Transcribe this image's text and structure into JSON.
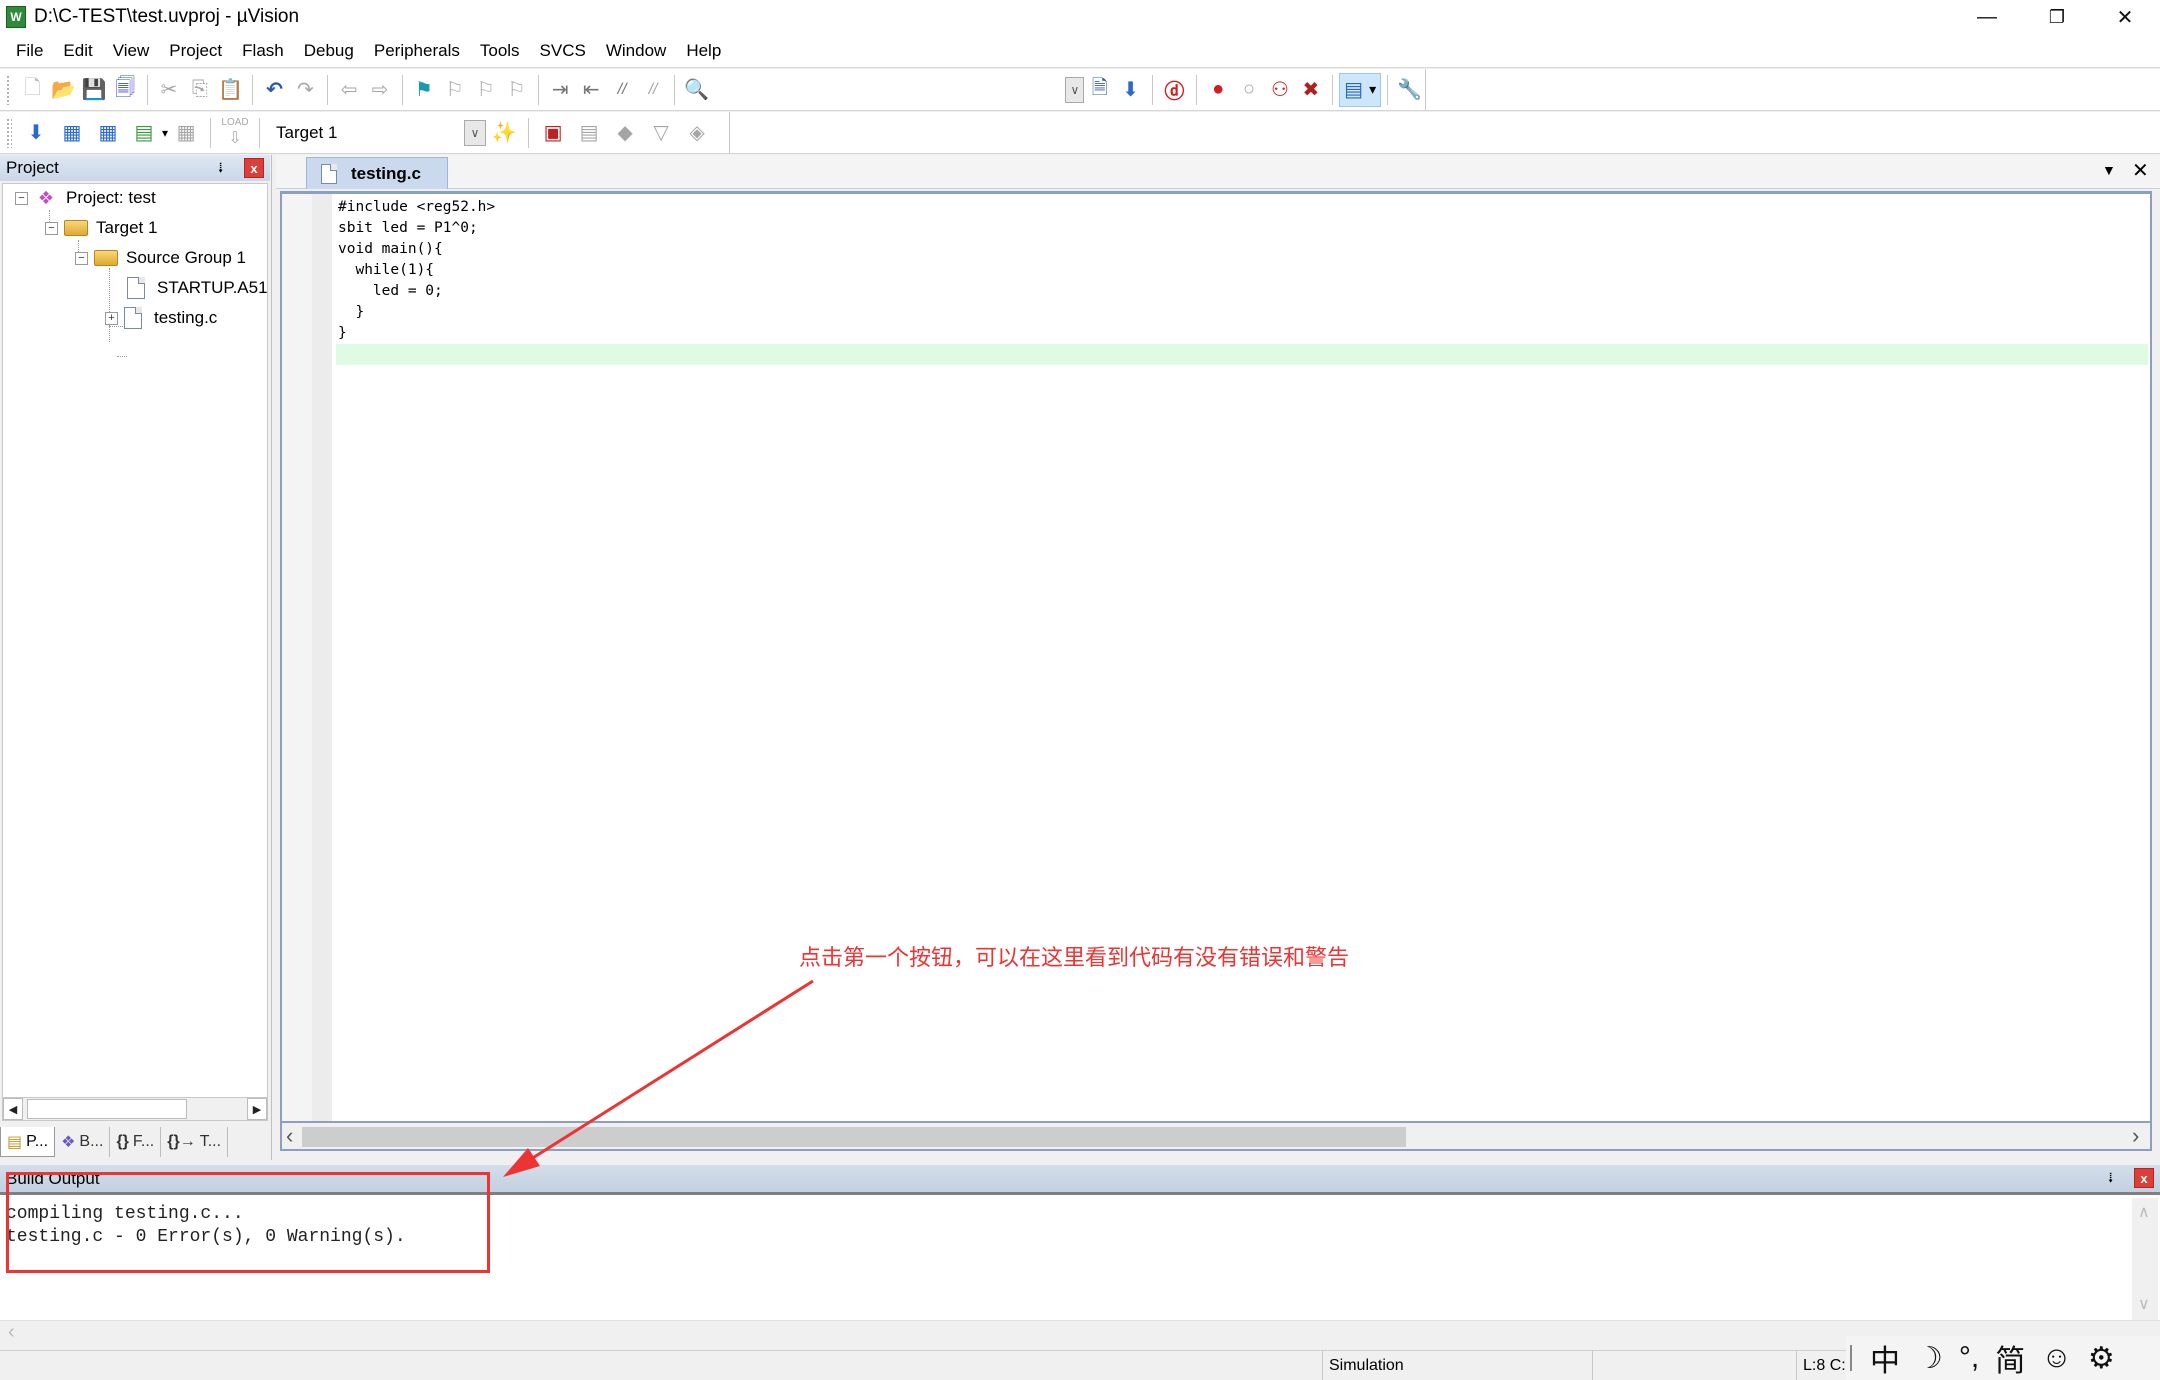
{
  "window": {
    "title": "D:\\C-TEST\\test.uvproj - µVision",
    "app_icon_label": "W",
    "minimize_glyph": "—",
    "restore_glyph": "❐",
    "close_glyph": "✕"
  },
  "menu": [
    "File",
    "Edit",
    "View",
    "Project",
    "Flash",
    "Debug",
    "Peripherals",
    "Tools",
    "SVCS",
    "Window",
    "Help"
  ],
  "toolbar1": {
    "icons": {
      "new": "🗋",
      "open": "📂",
      "save": "💾",
      "save_all": "🗐",
      "cut": "✂",
      "copy": "⎘",
      "paste": "📋",
      "undo": "↶",
      "redo": "↷",
      "nav_back": "⇦",
      "nav_forward": "⇨",
      "bookmark": "⚑",
      "prev_bookmark": "⚐",
      "next_bookmark": "⚐",
      "clear_bookmarks": "⚐",
      "indent": "⇥",
      "unindent": "⇤",
      "comment": "//",
      "uncomment": "//",
      "find_in_files": "🔍",
      "find": "🗎",
      "incremental_find": "⬇",
      "debug_session": "ⓓ",
      "breakpoint": "●",
      "disable_breakpoint": "○",
      "disable_all_breakpoints": "⚇",
      "kill_all_breakpoints": "✖",
      "window_layout": "▤",
      "dropdown": "▾",
      "configure": "🔧"
    },
    "combo_drop": "∨"
  },
  "toolbar2": {
    "icons": {
      "translate": "⬇",
      "build": "▦",
      "rebuild": "▦",
      "batch_build": "▤",
      "batch_dropdown": "▾",
      "stop_build": "▦",
      "download": "⇩",
      "target_options": "✨",
      "manage_components": "▣",
      "manage_project_items": "▤",
      "select_pack": "◆",
      "pack_installer": "▽",
      "rte": "◈"
    },
    "load_label": "LOAD",
    "target_select": "Target 1",
    "combo_drop": "∨"
  },
  "project_panel": {
    "title": "Project",
    "pin_glyph": "⭭",
    "close_glyph": "x",
    "tree": {
      "project": "Project: test",
      "target": "Target 1",
      "group": "Source Group 1",
      "files": [
        "STARTUP.A51",
        "testing.c"
      ]
    },
    "expander_minus": "−",
    "expander_plus": "+",
    "scroll_left": "◀",
    "scroll_right": "▶",
    "tabs": [
      {
        "icon": "▤",
        "label": "P..."
      },
      {
        "icon": "❖",
        "label": "B..."
      },
      {
        "icon": "{}",
        "label": "F..."
      },
      {
        "icon": "{}→",
        "label": "T..."
      }
    ]
  },
  "editor": {
    "tab_label": "testing.c",
    "tab_list_glyph": "▼",
    "tab_close_glyph": "✕",
    "code_lines": [
      "#include <reg52.h>",
      "sbit led = P1^0;",
      "void main(){",
      "  while(1){",
      "    led = 0;",
      "  }",
      "}"
    ],
    "current_line": 8,
    "scroll_left": "‹",
    "scroll_right": "›"
  },
  "build_output": {
    "title": "Build Output",
    "pin_glyph": "⭭",
    "close_glyph": "x",
    "lines": [
      "compiling testing.c...",
      "testing.c - 0 Error(s), 0 Warning(s)."
    ],
    "scroll_up": "∧",
    "scroll_down": "∨",
    "scroll_left": "‹"
  },
  "status_bar": {
    "mode": "Simulation",
    "position": "L:8 C:"
  },
  "ime_bar": {
    "items": [
      "中",
      "☽",
      "°,",
      "简",
      "☺",
      "⚙"
    ]
  },
  "annotation": {
    "text": "点击第一个按钮，可以在这里看到代码有没有错误和警告",
    "color": "#ee3333"
  },
  "colors": {
    "panel_header": "#c9d7e8",
    "tab_active": "#cbd9ef",
    "current_line": "#e0fbe4",
    "close_red": "#d9403a"
  }
}
